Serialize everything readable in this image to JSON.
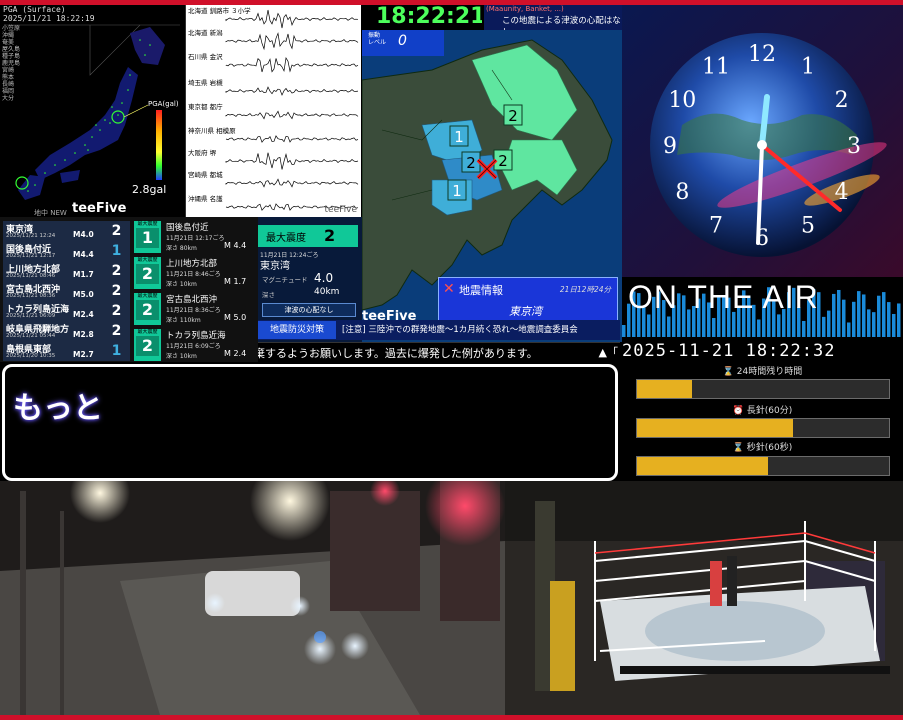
{
  "pga": {
    "header_line1": "PGA (Surface)",
    "header_line2": "2025/11/21 18:22:19",
    "scale_label": "PGA(gal)",
    "gal_value": "2.8gal",
    "jma_label": "地中 NEW",
    "brand": "teeFive",
    "station_labels": [
      "小笠原",
      "沖縄",
      "奄美",
      "屋久島",
      "種子島",
      "鹿児島",
      "宮崎",
      "熊本",
      "長崎",
      "福岡",
      "大分"
    ]
  },
  "seismograph": {
    "stations": [
      "北海道 釧路市 ３小学",
      "北海道 新潟",
      "石川県 金沢",
      "埼玉県 岩槻",
      "東京都 都庁",
      "神奈川県 相模原",
      "大阪府 堺",
      "宮崎県 都城",
      "沖縄県 名護"
    ],
    "brand": "teeFive"
  },
  "quake_list": [
    {
      "place": "東京湾",
      "date": "2025/11/21 12:24",
      "mag": "M4.0",
      "shindo": "2",
      "color": "#ffffff"
    },
    {
      "place": "国後島付近",
      "date": "2025/11/21 12:17",
      "mag": "M4.4",
      "shindo": "1",
      "color": "#3fb0e0"
    },
    {
      "place": "上川地方北部",
      "date": "2025/11/21 08:46",
      "mag": "M1.7",
      "shindo": "2",
      "color": "#ffffff"
    },
    {
      "place": "宮古島北西沖",
      "date": "2025/11/21 08:36",
      "mag": "M5.0",
      "shindo": "2",
      "color": "#ffffff"
    },
    {
      "place": "トカラ列島近海",
      "date": "2025/11/21 06:09",
      "mag": "M2.4",
      "shindo": "2",
      "color": "#ffffff"
    },
    {
      "place": "岐阜県飛騨地方",
      "date": "2025/11/21 05:44",
      "mag": "M2.8",
      "shindo": "2",
      "color": "#ffffff"
    },
    {
      "place": "島根県東部",
      "date": "2025/11/20 10:35",
      "mag": "M2.7",
      "shindo": "1",
      "color": "#3fb0e0"
    }
  ],
  "quake_detail": [
    {
      "level_label": "最大震度",
      "shindo": "1",
      "place": "国後島付近",
      "time": "11月21日 12:17ごろ",
      "depth": "深さ 80km",
      "mag": "M 4.4"
    },
    {
      "level_label": "最大震度",
      "shindo": "2",
      "place": "上川地方北部",
      "time": "11月21日 8:46ごろ",
      "depth": "深さ 10km",
      "mag": "M 1.7"
    },
    {
      "level_label": "最大震度",
      "shindo": "2",
      "place": "宮古島北西沖",
      "time": "11月21日 8:36ごろ",
      "depth": "深さ 110km",
      "mag": "M 5.0"
    },
    {
      "level_label": "最大震度",
      "shindo": "2",
      "place": "トカラ列島近海",
      "time": "11月21日 6:09ごろ",
      "depth": "深さ 10km",
      "mag": "M 2.4"
    }
  ],
  "max_intensity": {
    "title": "最大震度",
    "value": "2",
    "time": "11月21日 12:24ごろ",
    "place": "東京湾",
    "mag_label": "マグニチュード",
    "mag_value": "4.0",
    "depth_label": "深さ",
    "depth_value": "40km",
    "tsunami": "津波の心配なし"
  },
  "eew": {
    "clock": "18:22:21",
    "tsunami_top": "(Maaunity, Banket, ...)",
    "tsunami_msg": "この地震による津波の心配はなし",
    "level_label1": "振動",
    "level_label2": "レベル",
    "level_value": "0",
    "map_labels": [
      "1",
      "2",
      "2",
      "2",
      "1"
    ],
    "info_title": "地震情報",
    "info_date": "21日12時24分",
    "info_place": "東京湾",
    "brand": "teeFive"
  },
  "news": {
    "tag": "地震防災対策",
    "headline": "[注意] 三陸沖での群発地震〜1カ月続く恐れ〜地震調査委員会",
    "ticker": "棄するようお願いします。過去に爆発した例があります。",
    "ticker_end": "▲「"
  },
  "clock_panel": {
    "numbers": [
      "12",
      "1",
      "2",
      "3",
      "4",
      "5",
      "6",
      "7",
      "8",
      "9",
      "10",
      "11"
    ],
    "on_air": "ON THE AIR",
    "datetime": "2025-11-21 18:22:32"
  },
  "progress": [
    {
      "label": "⌛ 24時間残り時間",
      "fraction": 0.22
    },
    {
      "label": "⏰ 長針(60分)",
      "fraction": 0.62
    },
    {
      "label": "⌛ 秒針(60秒)",
      "fraction": 0.52
    }
  ],
  "comment": {
    "text": "もっと"
  }
}
